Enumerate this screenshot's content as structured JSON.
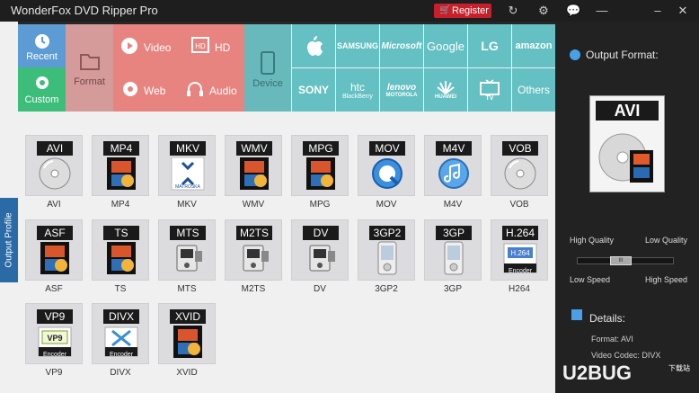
{
  "titlebar": {
    "title": "WonderFox DVD Ripper Pro",
    "register_label": "Register",
    "icons": [
      "refresh-icon",
      "gear-icon",
      "chat-icon",
      "minimize-icon",
      "close-icon"
    ]
  },
  "leftstrip": {
    "label": "Output Profile"
  },
  "categories": {
    "recent": "Recent",
    "custom": "Custom",
    "format": "Format",
    "video": "Video",
    "web": "Web",
    "hd": "HD",
    "audio": "Audio",
    "device": "Device"
  },
  "brands": [
    {
      "name": "apple",
      "label": ""
    },
    {
      "name": "samsung",
      "label": "SAMSUNG"
    },
    {
      "name": "microsoft",
      "label": "Microsoft"
    },
    {
      "name": "google",
      "label": "Google"
    },
    {
      "name": "lg",
      "label": "LG"
    },
    {
      "name": "amazon",
      "label": "amazon"
    },
    {
      "name": "sony",
      "label": "SONY"
    },
    {
      "name": "htc",
      "label": "htc"
    },
    {
      "name": "lenovo",
      "label": "lenovo"
    },
    {
      "name": "huawei",
      "label": "HUAWEI"
    },
    {
      "name": "tv",
      "label": "TV"
    },
    {
      "name": "others",
      "label": "Others"
    }
  ],
  "brand_sublabels": {
    "htc": "BlackBerry",
    "lenovo": "MOTOROLA"
  },
  "formats": [
    {
      "badge": "AVI",
      "label": "AVI",
      "art": "disc"
    },
    {
      "badge": "MP4",
      "label": "MP4",
      "art": "film"
    },
    {
      "badge": "MKV",
      "label": "MKV",
      "art": "matroska"
    },
    {
      "badge": "WMV",
      "label": "WMV",
      "art": "film"
    },
    {
      "badge": "MPG",
      "label": "MPG",
      "art": "film"
    },
    {
      "badge": "MOV",
      "label": "MOV",
      "art": "quicktime"
    },
    {
      "badge": "M4V",
      "label": "M4V",
      "art": "itunes"
    },
    {
      "badge": "VOB",
      "label": "VOB",
      "art": "disc"
    },
    {
      "badge": "ASF",
      "label": "ASF",
      "art": "film"
    },
    {
      "badge": "TS",
      "label": "TS",
      "art": "film"
    },
    {
      "badge": "MTS",
      "label": "MTS",
      "art": "camcorder"
    },
    {
      "badge": "M2TS",
      "label": "M2TS",
      "art": "camcorder"
    },
    {
      "badge": "DV",
      "label": "DV",
      "art": "camcorder"
    },
    {
      "badge": "3GP2",
      "label": "3GP2",
      "art": "phone"
    },
    {
      "badge": "3GP",
      "label": "3GP",
      "art": "phone"
    },
    {
      "badge": "H.264",
      "label": "H264",
      "art": "h264"
    },
    {
      "badge": "VP9",
      "label": "VP9",
      "art": "vp9"
    },
    {
      "badge": "DIVX",
      "label": "DIVX",
      "art": "divx"
    },
    {
      "badge": "XVID",
      "label": "XVID",
      "art": "film"
    }
  ],
  "encoder_label": "Encoder",
  "rightpanel": {
    "title": "Output Format:",
    "selected_badge": "AVI",
    "high_quality": "High Quality",
    "low_quality": "Low Quality",
    "low_speed": "Low Speed",
    "high_speed": "High Speed",
    "slider_knob": "III",
    "details_title": "Details:",
    "format_line": "Format: AVI",
    "codec_line": "Video Codec: DIVX"
  },
  "watermark": {
    "text": "U2BUG",
    "sub": "下载站"
  }
}
